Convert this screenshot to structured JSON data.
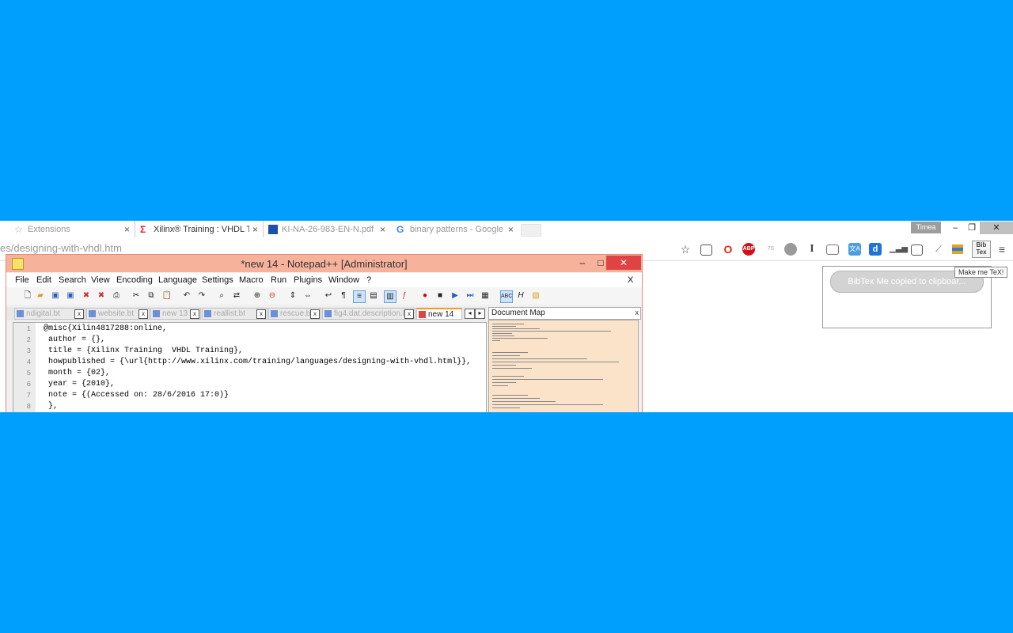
{
  "browser": {
    "tabs": [
      {
        "title": "Extensions",
        "close": "×"
      },
      {
        "title": "Xilinx® Training : VHDL T",
        "close": "×"
      },
      {
        "title": "KI-NA-26-983-EN-N.pdf",
        "close": "×"
      },
      {
        "title": "binary patterns - Google",
        "close": "×"
      }
    ],
    "user_button": "Timea",
    "window_controls": {
      "minimize": "–",
      "restore": "❐",
      "close": "✕"
    },
    "url": "es/designing-with-vhdl.htm",
    "extensions": {
      "bookmark": "☆",
      "ghostery": "👻",
      "grammarly": "I",
      "translate": "文A",
      "bibtex": "Bib Tex",
      "menu": "≡"
    }
  },
  "notepad": {
    "title": "*new  14 - Notepad++ [Administrator]",
    "window_controls": {
      "minimize": "–",
      "restore": "□",
      "close": "✕"
    },
    "menu": [
      "File",
      "Edit",
      "Search",
      "View",
      "Encoding",
      "Language",
      "Settings",
      "Macro",
      "Run",
      "Plugins",
      "Window",
      "?"
    ],
    "menu_close": "X",
    "doc_tabs": [
      {
        "title": "ndigital.bt",
        "close": "x"
      },
      {
        "title": "website.bt",
        "close": "x"
      },
      {
        "title": "new 13",
        "close": "x"
      },
      {
        "title": "reallist.bt",
        "close": "x"
      },
      {
        "title": "rescue.bt",
        "close": "x"
      },
      {
        "title": "fig4.dat.description.bt",
        "close": "x"
      },
      {
        "title": "new  14",
        "close": "x"
      }
    ],
    "line_numbers": [
      "1",
      "2",
      "3",
      "4",
      "5",
      "6",
      "7",
      "8"
    ],
    "code_lines": [
      "@misc{Xilin4817288:online,",
      " author = {},",
      " title = {Xilinx Training  VHDL Training},",
      " howpublished = {\\url{http://www.xilinx.com/training/languages/designing-with-vhdl.html}},",
      " month = {02},",
      " year = {2010},",
      " note = {(Accessed on: 28/6/2016 17:0)}",
      " },"
    ],
    "doc_map_title": "Document Map",
    "doc_map_close": "x"
  },
  "bibtex_popup": {
    "message": "BibTex Me copied to clipboar...",
    "tooltip": "Make me TeX!"
  }
}
